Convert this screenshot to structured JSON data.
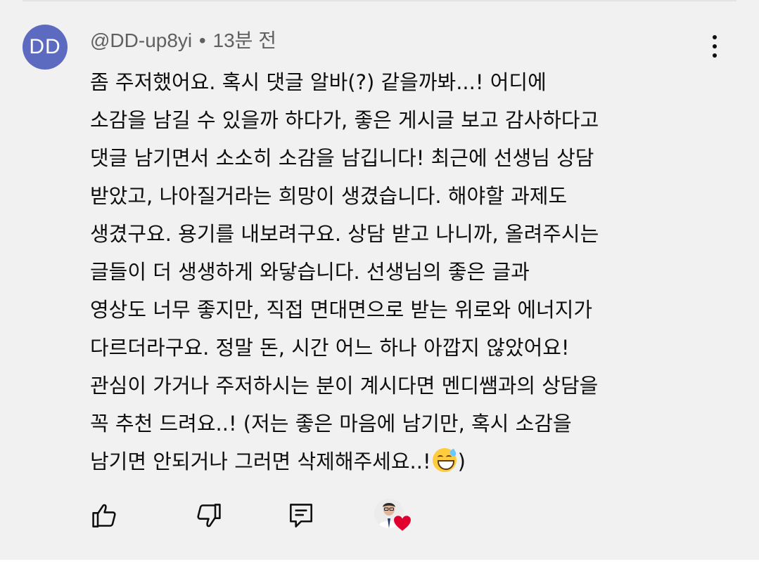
{
  "comment": {
    "avatar_initials": "DD",
    "avatar_color": "#5c6bc0",
    "author": "@DD-up8yi",
    "separator": "•",
    "timestamp": "13분 전",
    "menu_icon": "more-vert-icon",
    "lines": {
      "l1": "좀 주저했어요. 혹시 댓글 알바(?) 같을까봐...! 어디에",
      "l2": "소감을 남길 수 있을까 하다가, 좋은 게시글 보고 감사하다고",
      "l3": "댓글 남기면서 소소히 소감을 남깁니다! 최근에 선생님 상담",
      "l4": "받았고, 나아질거라는 희망이 생겼습니다. 해야할 과제도",
      "l5": "생겼구요. 용기를 내보려구요. 상담 받고 나니까, 올려주시는",
      "l6": "글들이 더 생생하게 와닿습니다. 선생님의 좋은 글과",
      "l7": "영상도 너무 좋지만, 직접 면대면으로 받는 위로와 에너지가",
      "l8": "다르더라구요. 정말 돈, 시간 어느 하나 아깝지 않았어요!",
      "l9": "관심이 가거나 주저하시는 분이 계시다면 멘디쌤과의 상담을",
      "l10": "꼭 추천 드려요..! (저는 좋은 마음에 남기만, 혹시 소감을",
      "l11_before_emoji": "남기면 안되거나 그러면 삭제해주세요..!",
      "l11_emoji": "grinning-face-with-sweat-emoji",
      "l11_after_emoji": ")"
    }
  },
  "actions": {
    "like_icon": "thumb-up-icon",
    "dislike_icon": "thumb-down-icon",
    "reply_icon": "reply-comment-icon",
    "creator_heart": "creator-heart-badge",
    "heart_color": "#e1002d"
  }
}
